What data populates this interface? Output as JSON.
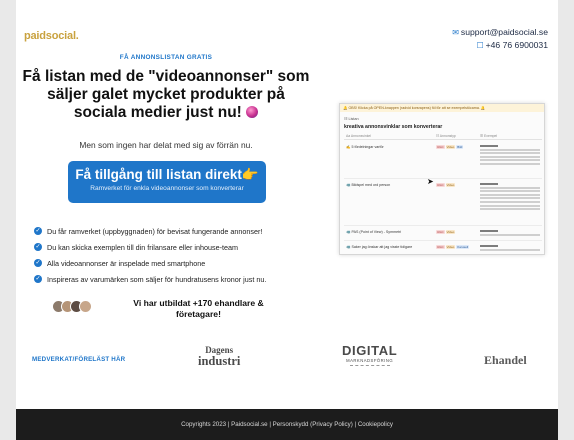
{
  "brand": {
    "logo_text": "paidsocial."
  },
  "contact": {
    "email": "support@paidsocial.se",
    "phone": "+46 76 6900031"
  },
  "hero": {
    "eyebrow": "FÅ ANNONSLISTAN GRATIS",
    "headline_line1": "Få listan med de \"videoannonser\" som",
    "headline_line2": "säljer galet mycket produkter på",
    "headline_line3": "sociala medier just nu!",
    "subheadline": "Men som ingen har delat med sig av förrän nu.",
    "cta_main": "Få tillgång till listan direkt👉",
    "cta_sub": "Ramverket för enkla videoannonser som konverterar"
  },
  "benefits": [
    "Du får ramverket (uppbyggnaden) för bevisat fungerande annonser!",
    "Du kan skicka exemplen till din frilansare eller inhouse-team",
    "Alla videoannonser är inspelade med smartphone",
    "Inspireras av varumärken som säljer för hundratusens kronor just nu."
  ],
  "social_proof": {
    "line1": "Vi har utbildat +170 ehandlare &",
    "line2": "företagare!"
  },
  "preview": {
    "banner": "🔔 OBS! Klicka på OPEN-knappen (radvid korsrapens) föl för att se exempelstöcarna. 🔔",
    "dropdown": "☷ Listan",
    "title": "kreativa annonsvinklar som konverterar",
    "col1": "Aa Annonsvinkel",
    "col2": "☷ Annonstyp",
    "col3": "☰ Exempel",
    "rows": [
      {
        "title": "✍️ 5 fördelningar varför",
        "tags": [
          "UGC",
          "Video",
          "Bild",
          "Karusell"
        ]
      },
      {
        "title": "🦏 Bildspel med ord person",
        "tags": [
          "UGC",
          "Video"
        ]
      },
      {
        "title": "🦏 PAS (Point of View) - Symmetri",
        "tags": [
          "UGC",
          "Video"
        ]
      },
      {
        "title": "🦏 Saker jag önskar att jag visste tidigare",
        "tags": [
          "UGC",
          "Video",
          "Karusell"
        ]
      }
    ]
  },
  "partners": {
    "lead": "MEDVERKAT/FÖRELÄST HÄR",
    "dagens_top": "Dagens",
    "dagens_bottom": "industri",
    "digital_top": "DIGITAL",
    "digital_bottom": "MARKNADSFÖRING",
    "ehandel": "Ehandel"
  },
  "footer": {
    "text": "Copyrights 2023 | Paidsocial.se | Personskydd (Privacy Policy) | Cookiepolicy"
  },
  "colors": {
    "accent": "#1f76c9",
    "logo": "#c9a23f",
    "footer_bg": "#1c1c1c"
  },
  "icons": {
    "email": "envelope-icon",
    "phone": "phone-icon",
    "check": "check-circle-icon",
    "cursor": "mouse-cursor-icon"
  }
}
